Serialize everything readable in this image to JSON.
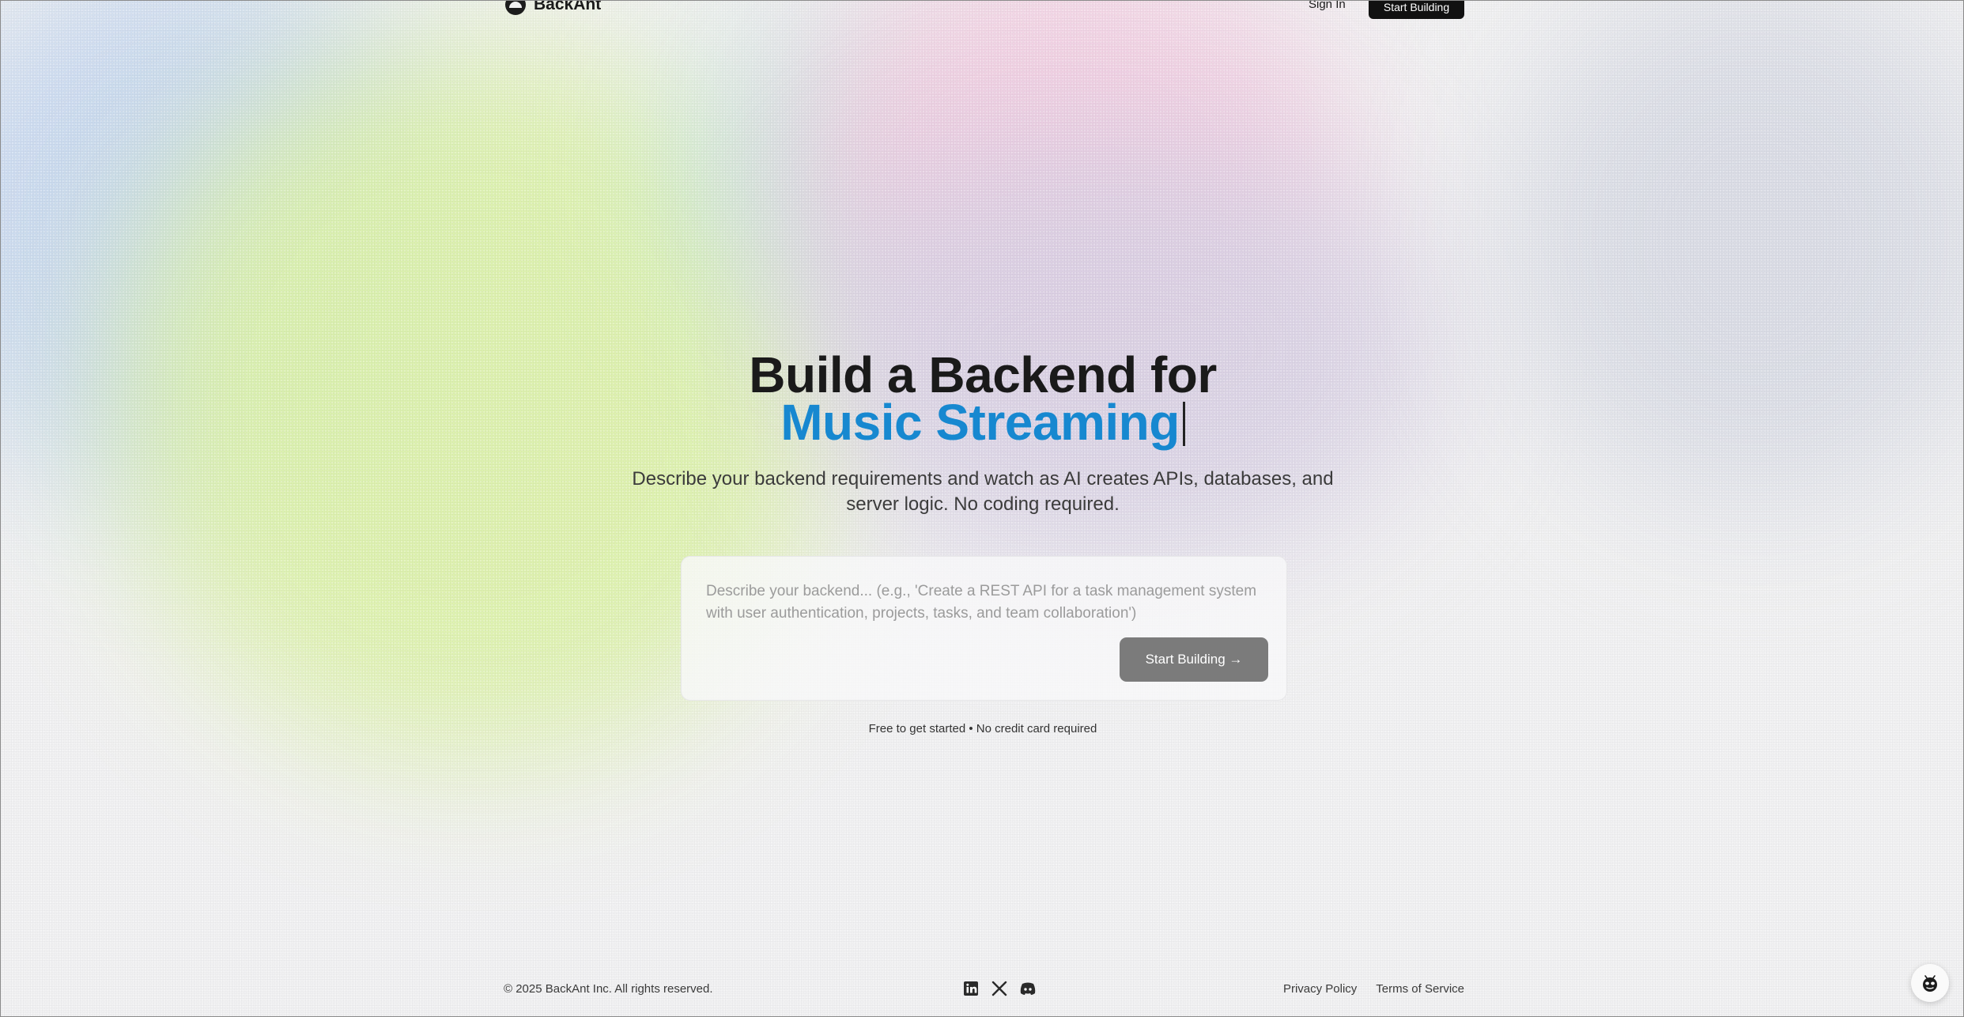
{
  "header": {
    "brand_name": "BackAnt",
    "signin_label": "Sign In",
    "cta_label": "Start Building"
  },
  "hero": {
    "headline_line1": "Build a Backend for",
    "headline_line2": "Music Streaming",
    "subtext": "Describe your backend requirements and watch as AI creates APIs, databases, and server logic. No coding required."
  },
  "prompt": {
    "placeholder": "Describe your backend... (e.g., 'Create a REST API for a task management system with user authentication, projects, tasks, and team collaboration')",
    "value": "",
    "submit_label": "Start Building →"
  },
  "note": "Free to get started • No credit card required",
  "footer": {
    "copyright": "© 2025 BackAnt Inc. All rights reserved.",
    "socials": [
      {
        "icon": "linkedin-icon"
      },
      {
        "icon": "x-icon"
      },
      {
        "icon": "discord-icon"
      }
    ],
    "links": [
      "Privacy Policy",
      "Terms of Service"
    ]
  },
  "colors": {
    "accent": "#1788d0",
    "cta_bg": "#111111",
    "submit_bg": "#7b7b7b"
  }
}
